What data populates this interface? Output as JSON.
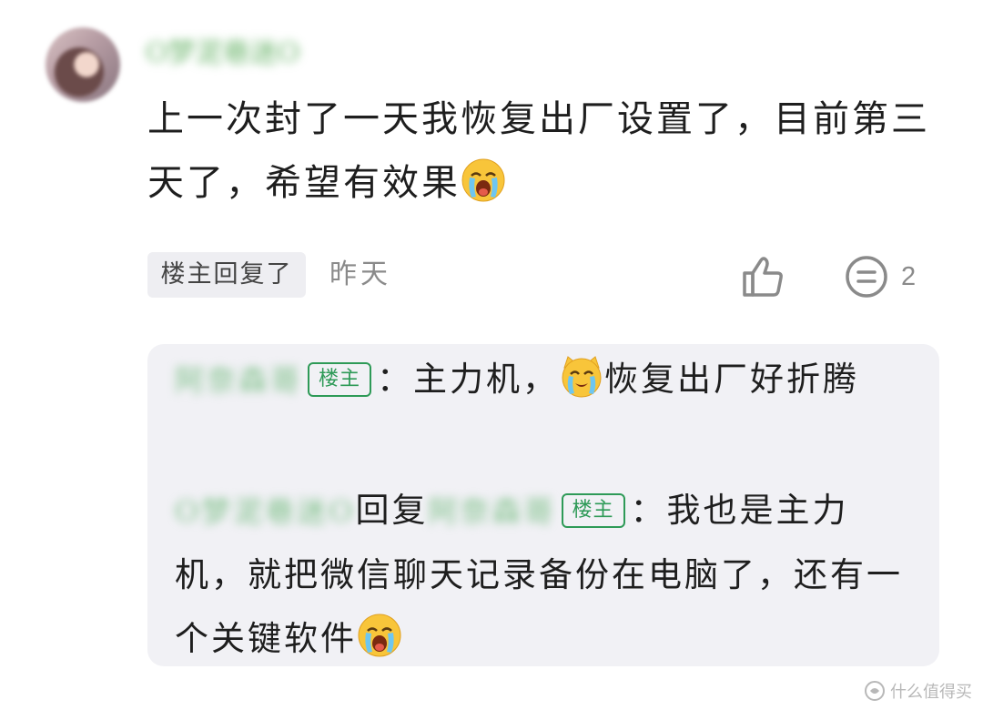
{
  "comment": {
    "username": "O梦泥巷迷O",
    "text": "上一次封了一天我恢复出厂设置了，目前第三天了，希望有效果",
    "emoji": "crying-face-emoji",
    "reply_tag": "楼主回复了",
    "time": "昨天",
    "like_icon": "thumbs-up-icon",
    "reply_icon": "comment-bubble-icon",
    "reply_count": "2"
  },
  "replies": [
    {
      "author": "阿奈森哥",
      "badge": "楼主",
      "separator": "：",
      "text_before_emoji": "主力机，",
      "emoji": "crying-cat-emoji",
      "text_after_emoji": "恢复出厂好折腾"
    },
    {
      "author": "O梦泥巷迷O",
      "reply_word": "回复",
      "target": "阿奈森哥",
      "badge": "楼主",
      "separator": "：",
      "text": "我也是主力机，就把微信聊天记录备份在电脑了，还有一个关键软件",
      "emoji": "crying-face-emoji"
    }
  ],
  "watermark": {
    "text": "什么值得买",
    "icon": "smzdm-logo-icon"
  },
  "colors": {
    "badge_green": "#2e9a57",
    "reply_bg": "#f1f1f5",
    "muted": "#8a8a8a"
  }
}
